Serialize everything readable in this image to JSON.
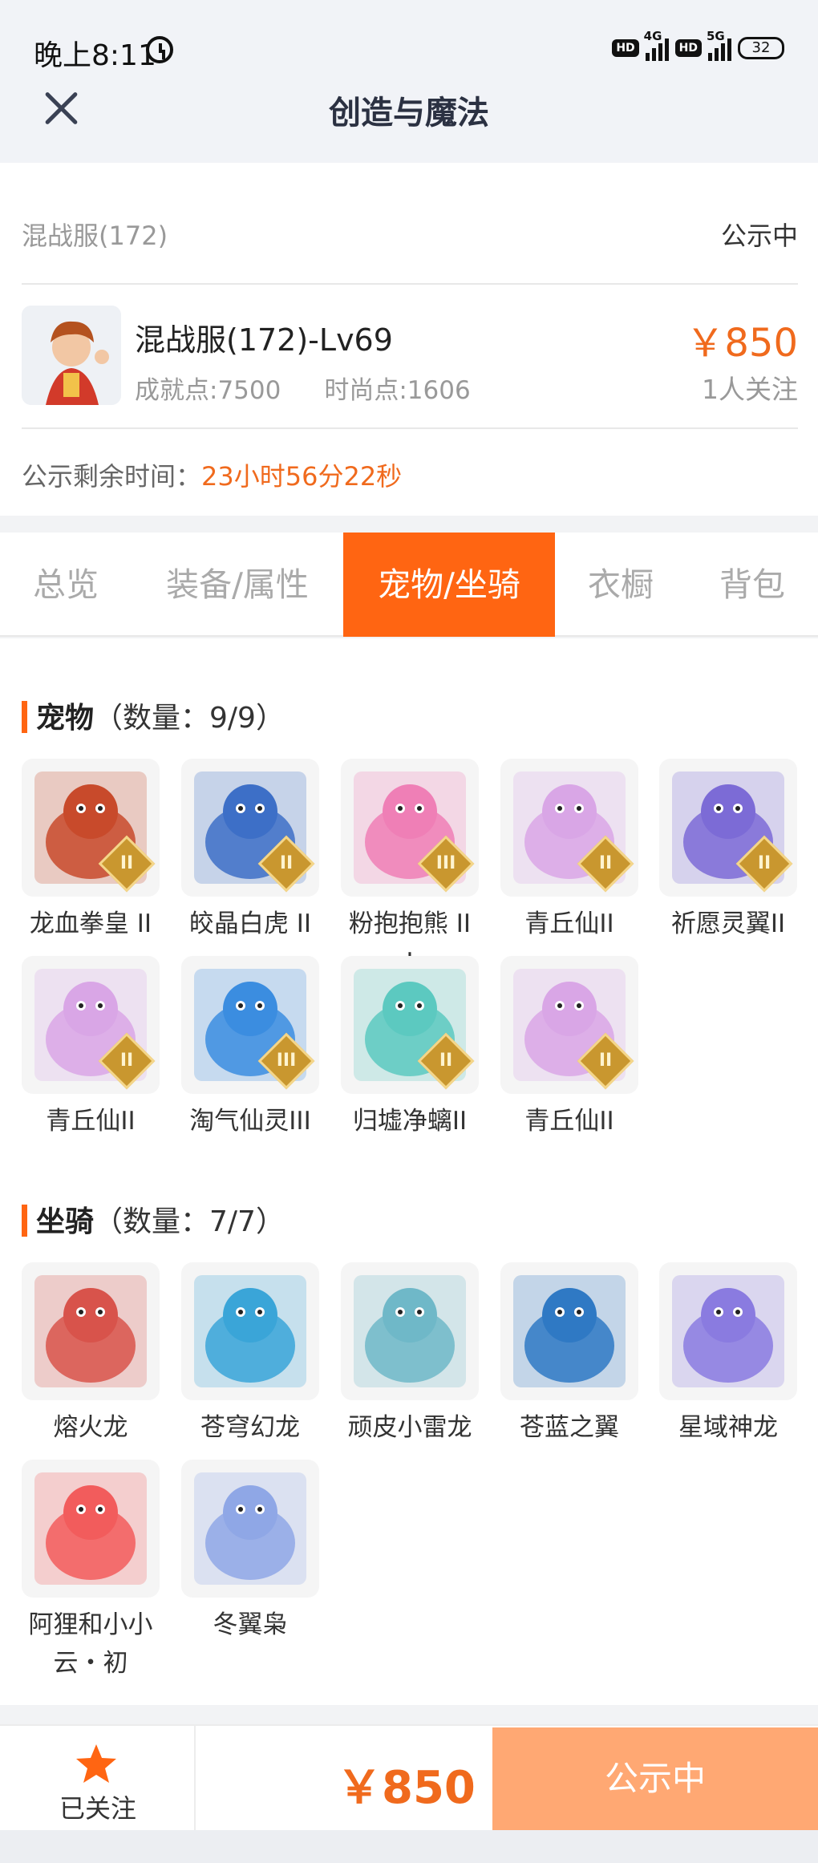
{
  "status_bar": {
    "time": "晚上8:11",
    "hd1": "HD",
    "net1": "4G",
    "hd2": "HD",
    "net2": "5G",
    "battery": "32"
  },
  "header": {
    "title": "创造与魔法"
  },
  "info": {
    "server": "混战服(172)",
    "status": "公示中",
    "character_name": "混战服(172)-Lv69",
    "achievement": "成就点:7500",
    "fashion": "时尚点:1606",
    "price": "￥850",
    "followers": "1人关注",
    "remaining_label": "公示剩余时间：",
    "remaining_time": "23小时56分22秒"
  },
  "tabs": [
    {
      "label": "总览",
      "active": false
    },
    {
      "label": "装备/属性",
      "active": false
    },
    {
      "label": "宠物/坐骑",
      "active": true
    },
    {
      "label": "衣橱",
      "active": false
    },
    {
      "label": "背包",
      "active": false
    }
  ],
  "pets": {
    "title": "宠物",
    "count": "（数量：9/9）",
    "items": [
      {
        "name": "龙血拳皇 II",
        "badge": "II",
        "color": "#c84a2b"
      },
      {
        "name": "皎晶白虎 II",
        "badge": "II",
        "color": "#3d6fc7"
      },
      {
        "name": "粉抱抱熊 III",
        "badge": "III",
        "color": "#ef7fb6"
      },
      {
        "name": "青丘仙II",
        "badge": "II",
        "color": "#d9a6e6"
      },
      {
        "name": "祈愿灵翼II",
        "badge": "II",
        "color": "#7c6bd6"
      },
      {
        "name": "青丘仙II",
        "badge": "II",
        "color": "#d9a6e6"
      },
      {
        "name": "淘气仙灵III",
        "badge": "III",
        "color": "#3b8de0"
      },
      {
        "name": "归墟净螭II",
        "badge": "II",
        "color": "#5cc9c0"
      },
      {
        "name": "青丘仙II",
        "badge": "II",
        "color": "#d9a6e6"
      }
    ]
  },
  "mounts": {
    "title": "坐骑",
    "count": "（数量：7/7）",
    "items": [
      {
        "name": "熔火龙",
        "color": "#d8534b"
      },
      {
        "name": "苍穹幻龙",
        "color": "#3aa5d8"
      },
      {
        "name": "顽皮小雷龙",
        "color": "#6fb8c8"
      },
      {
        "name": "苍蓝之翼",
        "color": "#2f79c4"
      },
      {
        "name": "星域神龙",
        "color": "#8a7be0"
      },
      {
        "name": "阿狸和小小云・初",
        "color": "#f25c5c"
      },
      {
        "name": "冬翼枭",
        "color": "#8fa7e6"
      }
    ]
  },
  "bottom_bar": {
    "follow_label": "已关注",
    "price": "￥850",
    "cta": "公示中"
  }
}
